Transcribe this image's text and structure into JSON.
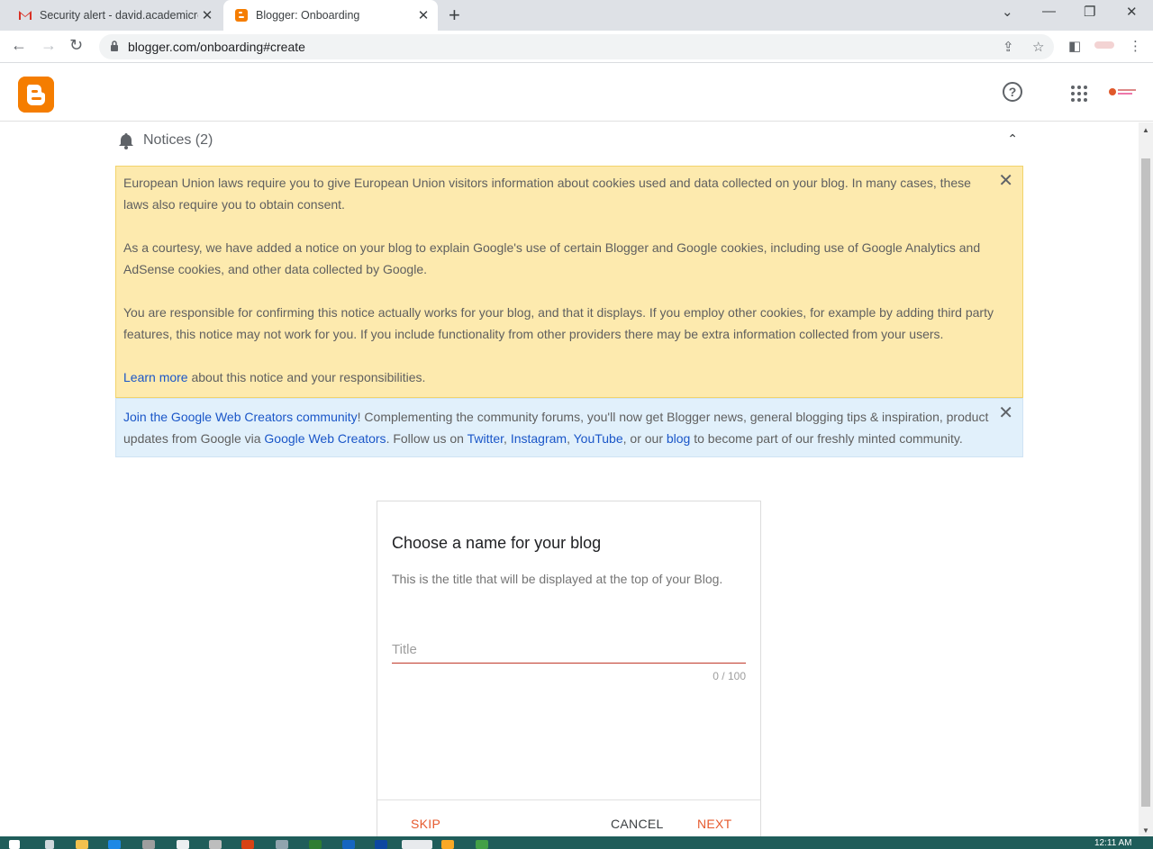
{
  "browser": {
    "tabs": [
      {
        "title": "Security alert - david.academicre"
      },
      {
        "title": "Blogger: Onboarding"
      }
    ],
    "url": "blogger.com/onboarding#create"
  },
  "notices": {
    "heading": "Notices (2)",
    "eu_paragraph_1": "European Union laws require you to give European Union visitors information about cookies used and data collected on your blog. In many cases, these laws also require you to obtain consent.",
    "eu_paragraph_2": "As a courtesy, we have added a notice on your blog to explain Google's use of certain Blogger and Google cookies, including use of Google Analytics and AdSense cookies, and other data collected by Google.",
    "eu_paragraph_3": "You are responsible for confirming this notice actually works for your blog, and that it displays. If you employ other cookies, for example by adding third party features, this notice may not work for you. If you include functionality from other providers there may be extra information collected from your users.",
    "learn_more_link": "Learn more",
    "learn_more_rest": " about this notice and your responsibilities.",
    "community": {
      "join_link": "Join the Google Web Creators community",
      "text_1": "! Complementing the community forums, you'll now get Blogger news, general blogging tips & inspiration, product updates from Google via ",
      "gwc_link": "Google Web Creators",
      "text_2": ". Follow us on ",
      "twitter": "Twitter",
      "comma_1": ", ",
      "instagram": "Instagram",
      "comma_2": ", ",
      "youtube": "YouTube",
      "text_3": ", or our ",
      "blog": "blog",
      "text_4": " to become part of our freshly minted community."
    }
  },
  "dialog": {
    "title": "Choose a name for your blog",
    "subtitle": "This is the title that will be displayed at the top of your Blog.",
    "input_value": "",
    "input_placeholder": "Title",
    "counter": "0 / 100",
    "skip": "SKIP",
    "cancel": "CANCEL",
    "next": "NEXT"
  },
  "taskbar": {
    "clock": "12:11 AM"
  },
  "colors": {
    "blogger_orange": "#f57d00",
    "accent_red": "#e65a2e",
    "notice_yellow": "#fdeaae",
    "notice_blue": "#e1f0fb",
    "link_blue": "#1a56c8"
  }
}
